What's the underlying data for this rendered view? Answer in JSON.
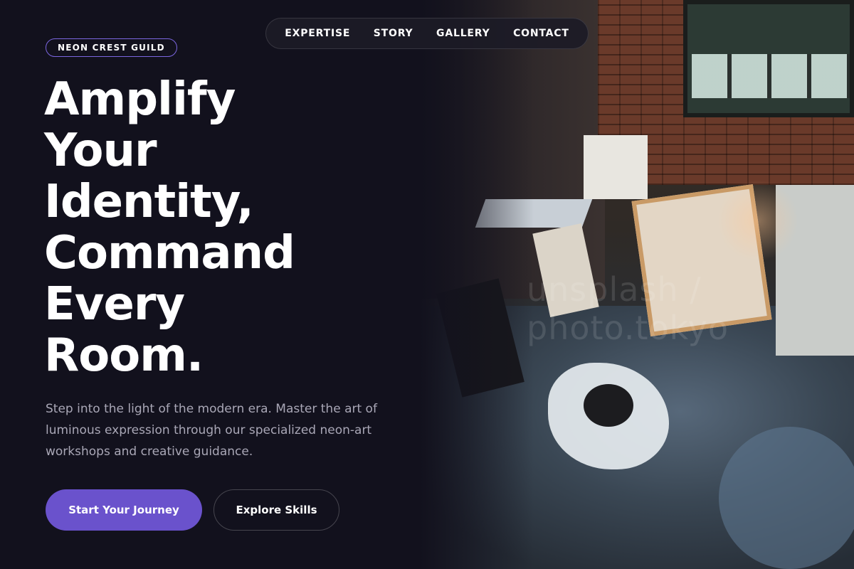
{
  "nav": {
    "items": [
      {
        "label": "EXPERTISE"
      },
      {
        "label": "STORY"
      },
      {
        "label": "GALLERY"
      },
      {
        "label": "CONTACT"
      }
    ]
  },
  "hero": {
    "badge": "NEON CREST GUILD",
    "headline_lines": [
      "Amplify",
      "Your",
      "Identity,",
      "Command",
      "Every",
      "Room."
    ],
    "description": "Step into the light of the modern era. Master the art of luminous expression through our specialized neon-art workshops and creative guidance.",
    "primary_cta": "Start Your Journey",
    "secondary_cta": "Explore Skills"
  },
  "photo": {
    "watermark": "unsplash / photo.tokyo",
    "subject": "art studio interior"
  },
  "colors": {
    "background": "#12111d",
    "accent": "#6a52cc",
    "badge_border": "#7b66e0",
    "body_text": "#a9a7b6"
  }
}
